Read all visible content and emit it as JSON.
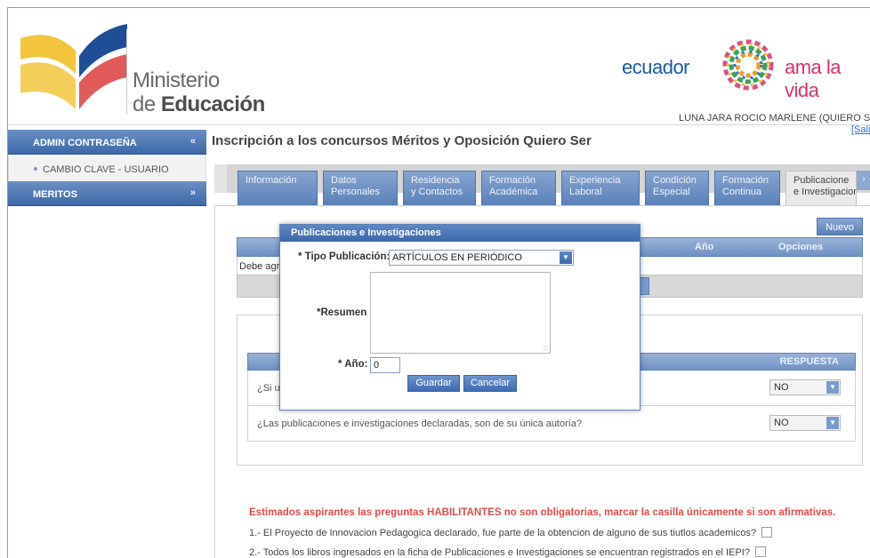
{
  "header": {
    "ministry_line1": "Ministerio",
    "ministry_line2_prefix": "de ",
    "ministry_line2_bold": "Educación",
    "brand_left": "ecuador",
    "brand_right": "ama la vida",
    "user_name": "LUNA JARA ROCIO MARLENE (QUIERO SER",
    "logout": "[Salir"
  },
  "sidebar": {
    "sections": [
      {
        "label": "ADMIN CONTRASEÑA",
        "chevron": "«"
      },
      {
        "label": "MERITOS",
        "chevron": "»"
      }
    ],
    "items": [
      {
        "label": "CAMBIO CLAVE - USUARIO"
      }
    ]
  },
  "main": {
    "title": "Inscripción a los concursos Méritos y Oposición Quiero Ser",
    "tabs": [
      {
        "line1": "Información",
        "line2": ""
      },
      {
        "line1": "Datos",
        "line2": "Personales"
      },
      {
        "line1": "Residencia",
        "line2": "y Contactos"
      },
      {
        "line1": "Formación",
        "line2": "Académica"
      },
      {
        "line1": "Experiencia",
        "line2": "Laboral"
      },
      {
        "line1": "Condición",
        "line2": "Especial"
      },
      {
        "line1": "Formación",
        "line2": "Continua"
      },
      {
        "line1": "Publicacione",
        "line2": "e Investigacion"
      }
    ],
    "new_button": "Nuevo",
    "grid": {
      "headers": [
        "Año",
        "Opciones"
      ],
      "empty_text": "Debe agr"
    },
    "questions": {
      "header": "RESPUESTA",
      "rows": [
        {
          "text": "¿Si u",
          "answer": "NO"
        },
        {
          "text": "¿Las publicaciones e investigaciones declaradas, son de su única autoría?",
          "answer": "NO"
        }
      ]
    },
    "notice": "Estimados aspirantes las preguntas HABILITANTES no son obligatorias, marcar la casilla únicamente si son afirmativas.",
    "checks": [
      "1.- El Proyecto de Innovacion Pedagogica declarado, fue parte de la obtencion de alguno de sus tiutlos academicos?",
      "2.- Todos los libros ingresados en la ficha de Publicaciones e Investigaciones se encuentran registrados en el IEPI?"
    ]
  },
  "modal": {
    "title": "Publicaciones e Investigaciones",
    "tipo_label": "* Tipo Publicación:",
    "tipo_value": "ARTÍCULOS EN PERIÓDICO",
    "resumen_label": "*Resumen",
    "resumen_value": "",
    "anio_label": "* Año:",
    "anio_value": "0",
    "save": "Guardar",
    "cancel": "Cancelar"
  }
}
